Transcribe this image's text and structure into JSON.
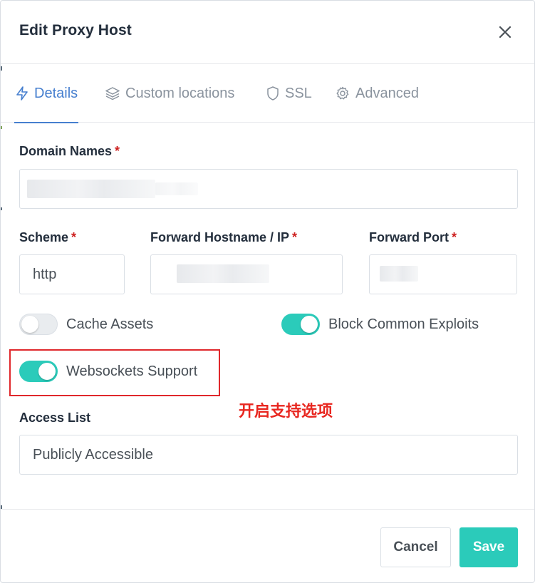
{
  "dialog": {
    "title": "Edit Proxy Host"
  },
  "tabs": [
    {
      "label": "Details",
      "icon": "bolt-icon",
      "active": true
    },
    {
      "label": "Custom locations",
      "icon": "layers-icon",
      "active": false
    },
    {
      "label": "SSL",
      "icon": "shield-icon",
      "active": false
    },
    {
      "label": "Advanced",
      "icon": "gear-icon",
      "active": false
    }
  ],
  "form": {
    "domain_names": {
      "label": "Domain Names",
      "required": "*"
    },
    "scheme": {
      "label": "Scheme",
      "required": "*",
      "value": "http"
    },
    "forward_hostname": {
      "label": "Forward Hostname / IP",
      "required": "*"
    },
    "forward_port": {
      "label": "Forward Port",
      "required": "*"
    },
    "cache_assets": {
      "label": "Cache Assets",
      "enabled": false
    },
    "block_exploits": {
      "label": "Block Common Exploits",
      "enabled": true
    },
    "websockets": {
      "label": "Websockets Support",
      "enabled": true
    },
    "access_list": {
      "label": "Access List",
      "value": "Publicly Accessible"
    }
  },
  "annotation": {
    "text": "开启支持选项",
    "color": "#e8261f"
  },
  "footer": {
    "cancel_label": "Cancel",
    "save_label": "Save"
  },
  "colors": {
    "accent": "#467fcf",
    "toggle_on": "#2bcbba",
    "required": "#cd201f",
    "highlight": "#e0282c"
  }
}
